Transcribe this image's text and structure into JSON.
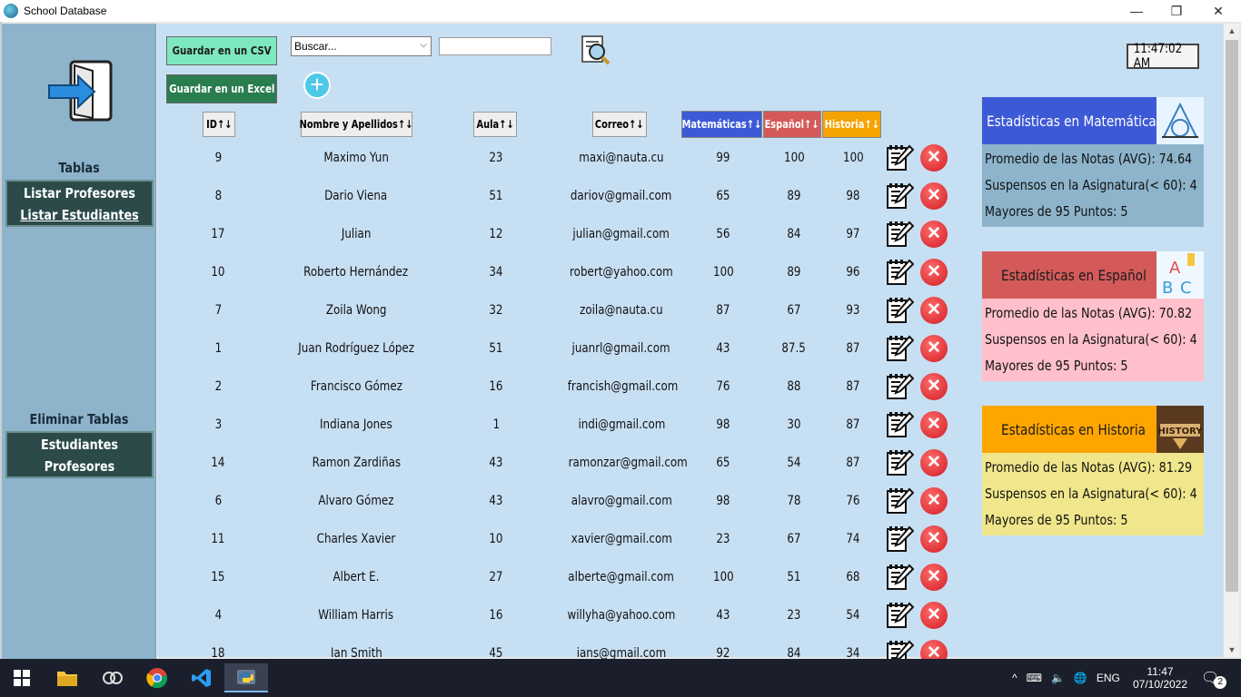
{
  "window": {
    "title": "School Database",
    "minimize": "—",
    "restore": "❐",
    "close": "✕"
  },
  "sidebar": {
    "tables_heading": "Tablas",
    "list_teachers": "Listar Profesores",
    "list_students": "Listar Estudiantes",
    "delete_heading": "Eliminar Tablas",
    "delete_students": "Estudiantes",
    "delete_teachers": "Profesores"
  },
  "toolbar": {
    "save_csv": "Guardar en un CSV",
    "save_excel": "Guardar en un Excel",
    "search_select": "Buscar...",
    "search_value": "",
    "clock": "11:47:02 AM"
  },
  "table": {
    "headers": {
      "id": "ID↑↓",
      "name": "Nombre y Apellidos↑↓",
      "room": "Aula↑↓",
      "email": "Correo↑↓",
      "math": "Matemáticas↑↓",
      "spanish": "Español↑↓",
      "history": "Historia↑↓"
    },
    "header_colors": {
      "math": "#3d5ad6",
      "spanish": "#d45a5a",
      "history": "#f5a300"
    },
    "rows": [
      {
        "id": "9",
        "name": "Maximo Yun",
        "room": "23",
        "email": "maxi@nauta.cu",
        "math": "99",
        "spanish": "100",
        "history": "100"
      },
      {
        "id": "8",
        "name": "Dario Viena",
        "room": "51",
        "email": "dariov@gmail.com",
        "math": "65",
        "spanish": "89",
        "history": "98"
      },
      {
        "id": "17",
        "name": "Julian",
        "room": "12",
        "email": "julian@gmail.com",
        "math": "56",
        "spanish": "84",
        "history": "97"
      },
      {
        "id": "10",
        "name": "Roberto Hernández",
        "room": "34",
        "email": "robert@yahoo.com",
        "math": "100",
        "spanish": "89",
        "history": "96"
      },
      {
        "id": "7",
        "name": "Zoila Wong",
        "room": "32",
        "email": "zoila@nauta.cu",
        "math": "87",
        "spanish": "67",
        "history": "93"
      },
      {
        "id": "1",
        "name": "Juan Rodríguez López",
        "room": "51",
        "email": "juanrl@gmail.com",
        "math": "43",
        "spanish": "87.5",
        "history": "87"
      },
      {
        "id": "2",
        "name": "Francisco Gómez",
        "room": "16",
        "email": "francish@gmail.com",
        "math": "76",
        "spanish": "88",
        "history": "87"
      },
      {
        "id": "3",
        "name": "Indiana Jones",
        "room": "1",
        "email": "indi@gmail.com",
        "math": "98",
        "spanish": "30",
        "history": "87"
      },
      {
        "id": "14",
        "name": "Ramon Zardiñas",
        "room": "43",
        "email": "ramonzar@gmail.com",
        "math": "65",
        "spanish": "54",
        "history": "87"
      },
      {
        "id": "6",
        "name": "Alvaro Gómez",
        "room": "43",
        "email": "alavro@gmail.com",
        "math": "98",
        "spanish": "78",
        "history": "76"
      },
      {
        "id": "11",
        "name": "Charles Xavier",
        "room": "10",
        "email": "xavier@gmail.com",
        "math": "23",
        "spanish": "67",
        "history": "74"
      },
      {
        "id": "15",
        "name": "Albert E.",
        "room": "27",
        "email": "alberte@gmail.com",
        "math": "100",
        "spanish": "51",
        "history": "68"
      },
      {
        "id": "4",
        "name": "William Harris",
        "room": "16",
        "email": "willyha@yahoo.com",
        "math": "43",
        "spanish": "23",
        "history": "54"
      },
      {
        "id": "18",
        "name": "Ian Smith",
        "room": "45",
        "email": "ians@gmail.com",
        "math": "92",
        "spanish": "84",
        "history": "34"
      }
    ]
  },
  "stats": [
    {
      "title": "Estadísticas en Matemáticas",
      "icon": "math-icon",
      "head_color": "#3d5ad6",
      "body_color": "#8db4cb",
      "text_color": "#ffffff",
      "avg": "Promedio de las Notas (AVG): 74.64",
      "failed": "Suspensos en la Asignatura(< 60): 4",
      "top": "Mayores de 95 Puntos: 5"
    },
    {
      "title": "Estadísticas en Español",
      "icon": "abc-icon",
      "head_color": "#d45a5a",
      "body_color": "#ffc0cb",
      "text_color": "#1a1a1a",
      "avg": "Promedio de las Notas (AVG): 70.82",
      "failed": "Suspensos en la Asignatura(< 60): 4",
      "top": "Mayores de 95 Puntos: 5"
    },
    {
      "title": "Estadísticas en Historia",
      "icon": "history-icon",
      "head_color": "#ffa500",
      "body_color": "#f0e68c",
      "text_color": "#1a1a1a",
      "avg": "Promedio de las Notas (AVG): 81.29",
      "failed": "Suspensos en la Asignatura(< 60): 4",
      "top": "Mayores de 95 Puntos: 5"
    }
  ],
  "history_icon_text": "HISTORY",
  "taskbar": {
    "lang": "ENG",
    "time": "11:47",
    "date": "07/10/2022",
    "notifications": "2",
    "apps": [
      "windows-start-icon",
      "file-explorer-icon",
      "eye-app-icon",
      "chrome-icon",
      "vscode-icon",
      "python-icon"
    ]
  }
}
